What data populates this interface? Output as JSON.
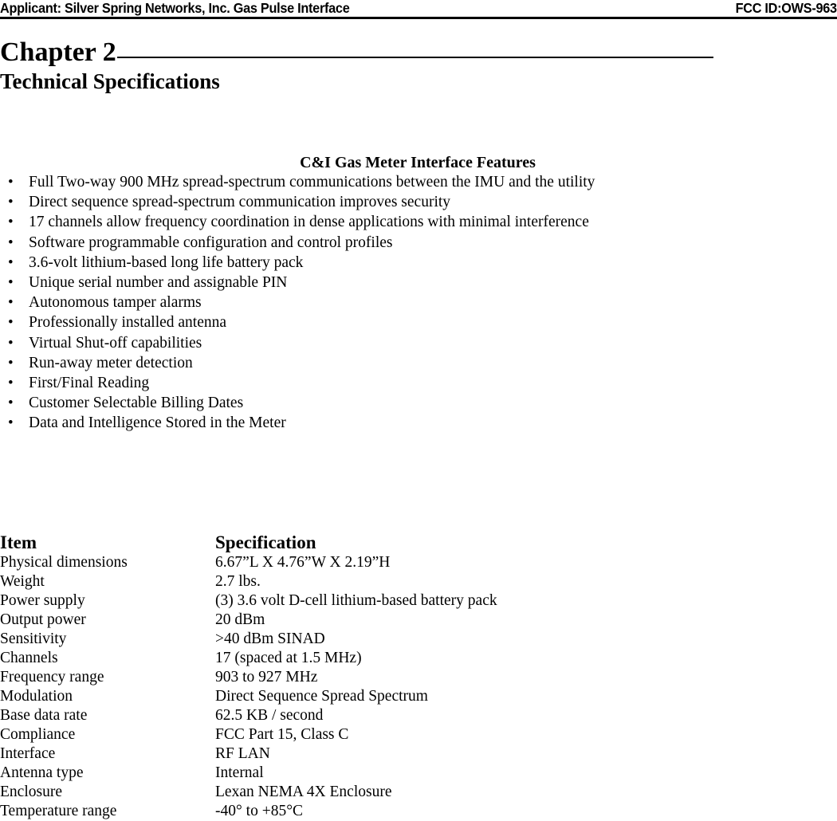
{
  "header": {
    "applicant": "Applicant:  Silver Spring Networks, Inc. Gas Pulse Interface",
    "fcc_id": "FCC ID:OWS-963"
  },
  "chapter": {
    "title": "Chapter 2",
    "subtitle": "Technical Specifications"
  },
  "features": {
    "heading": "C&I Gas Meter Interface Features",
    "bullet_glyph": "•",
    "items": [
      "Full Two-way 900 MHz spread-spectrum communications between the IMU and the utility",
      "Direct sequence spread-spectrum communication improves security",
      "17 channels allow frequency coordination in dense applications with minimal interference",
      "Software programmable configuration and control profiles",
      "3.6-volt lithium-based long life battery pack",
      "Unique serial number and assignable PIN",
      "Autonomous tamper alarms",
      "Professionally installed antenna",
      "Virtual Shut-off capabilities",
      "Run-away meter detection",
      "First/Final Reading",
      "Customer Selectable Billing Dates",
      "Data and Intelligence Stored in the Meter"
    ]
  },
  "spec_table": {
    "columns": [
      "Item",
      "Specification"
    ],
    "rows": [
      {
        "item": "Physical dimensions",
        "spec": "6.67”L X 4.76”W X 2.19”H"
      },
      {
        "item": "Weight",
        "spec": "2.7 lbs."
      },
      {
        "item": "Power supply",
        "spec": "(3) 3.6 volt D-cell lithium-based battery pack"
      },
      {
        "item": "Output power",
        "spec": "20 dBm"
      },
      {
        "item": "Sensitivity",
        "spec": ">40 dBm SINAD"
      },
      {
        "item": "Channels",
        "spec": "17 (spaced at 1.5 MHz)"
      },
      {
        "item": "Frequency range",
        "spec": "903 to 927 MHz"
      },
      {
        "item": "Modulation",
        "spec": "Direct Sequence Spread Spectrum"
      },
      {
        "item": "Base data rate",
        "spec": "62.5 KB / second"
      },
      {
        "item": "Compliance",
        "spec": "FCC Part 15, Class C"
      },
      {
        "item": "Interface",
        "spec": "RF LAN"
      },
      {
        "item": "Antenna type",
        "spec": "Internal"
      },
      {
        "item": "Enclosure",
        "spec": "Lexan NEMA 4X Enclosure"
      },
      {
        "item": "Temperature range",
        "spec": "-40° to +85°C"
      }
    ]
  }
}
